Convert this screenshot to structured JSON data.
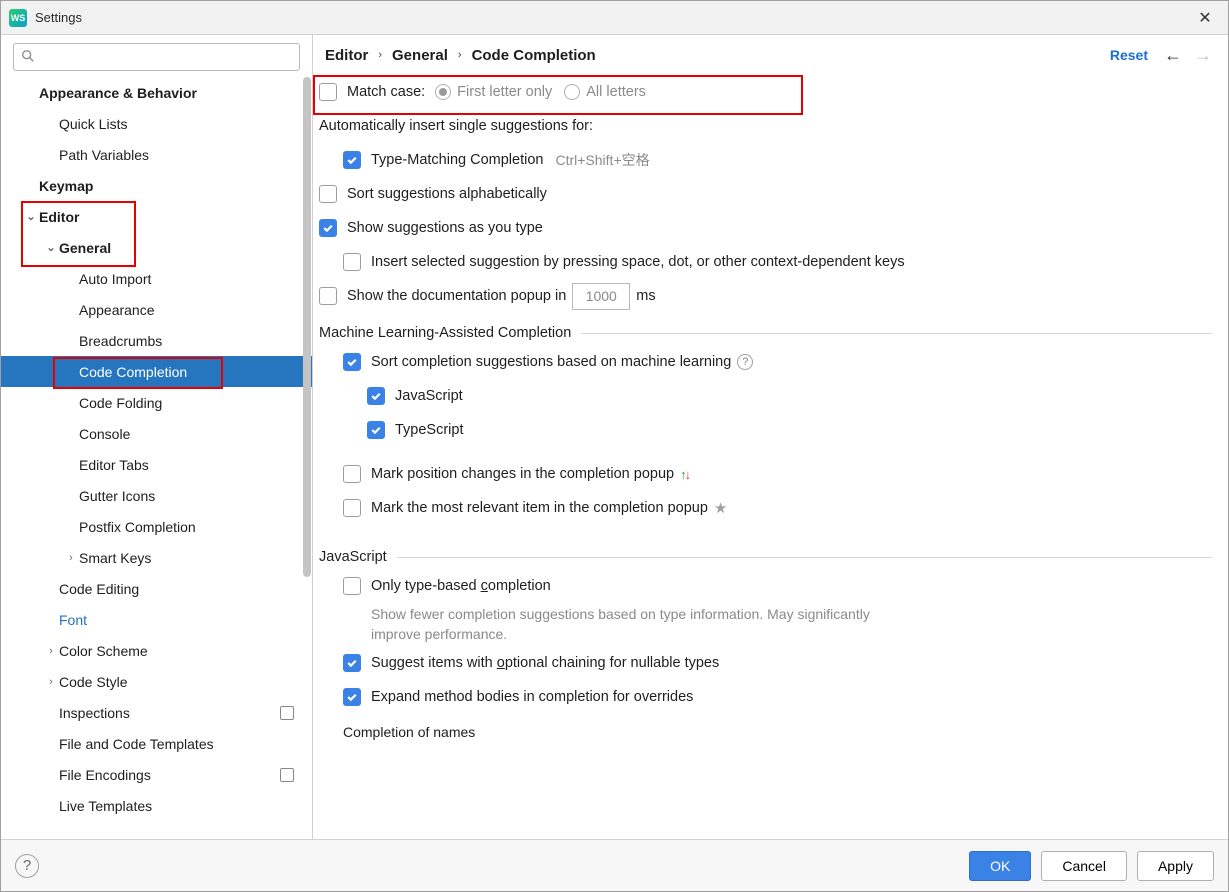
{
  "window": {
    "title": "Settings",
    "app_icon_text": "WS"
  },
  "search": {
    "placeholder": ""
  },
  "sidebar": [
    {
      "label": "Appearance & Behavior",
      "lvl": 0,
      "bold": true
    },
    {
      "label": "Quick Lists",
      "lvl": 1
    },
    {
      "label": "Path Variables",
      "lvl": 1
    },
    {
      "label": "Keymap",
      "lvl": 0,
      "bold": true
    },
    {
      "label": "Editor",
      "lvl": 0,
      "bold": true,
      "chev": "down"
    },
    {
      "label": "General",
      "lvl": 1,
      "bold": true,
      "chev": "down"
    },
    {
      "label": "Auto Import",
      "lvl": 2
    },
    {
      "label": "Appearance",
      "lvl": 2
    },
    {
      "label": "Breadcrumbs",
      "lvl": 2
    },
    {
      "label": "Code Completion",
      "lvl": 2,
      "selected": true
    },
    {
      "label": "Code Folding",
      "lvl": 2
    },
    {
      "label": "Console",
      "lvl": 2
    },
    {
      "label": "Editor Tabs",
      "lvl": 2
    },
    {
      "label": "Gutter Icons",
      "lvl": 2
    },
    {
      "label": "Postfix Completion",
      "lvl": 2
    },
    {
      "label": "Smart Keys",
      "lvl": 2,
      "chev": "right"
    },
    {
      "label": "Code Editing",
      "lvl": 1
    },
    {
      "label": "Font",
      "lvl": 1,
      "link": true
    },
    {
      "label": "Color Scheme",
      "lvl": 1,
      "chev": "right"
    },
    {
      "label": "Code Style",
      "lvl": 1,
      "chev": "right"
    },
    {
      "label": "Inspections",
      "lvl": 1,
      "proj": true
    },
    {
      "label": "File and Code Templates",
      "lvl": 1
    },
    {
      "label": "File Encodings",
      "lvl": 1,
      "proj": true
    },
    {
      "label": "Live Templates",
      "lvl": 1
    }
  ],
  "breadcrumb": [
    "Editor",
    "General",
    "Code Completion"
  ],
  "reset_label": "Reset",
  "options": {
    "match_case": {
      "label": "Match case:",
      "checked": false,
      "first_letter": "First letter only",
      "all_letters": "All letters",
      "radio_sel": "first"
    },
    "auto_insert_hdr": "Automatically insert single suggestions for:",
    "type_matching": {
      "label": "Type-Matching Completion",
      "checked": true,
      "kbd": "Ctrl+Shift+空格"
    },
    "sort_alpha": {
      "label": "Sort suggestions alphabetically",
      "checked": false
    },
    "show_as_type": {
      "label": "Show suggestions as you type",
      "checked": true
    },
    "insert_space": {
      "label": "Insert selected suggestion by pressing space, dot, or other context-dependent keys",
      "checked": false
    },
    "show_doc": {
      "label_pre": "Show the documentation popup in",
      "value": "1000",
      "label_post": "ms",
      "checked": false
    },
    "ml_hdr": "Machine Learning-Assisted Completion",
    "ml_sort": {
      "label": "Sort completion suggestions based on machine learning",
      "checked": true
    },
    "ml_js": {
      "label": "JavaScript",
      "checked": true
    },
    "ml_ts": {
      "label": "TypeScript",
      "checked": true
    },
    "mark_pos": {
      "label": "Mark position changes in the completion popup",
      "checked": false
    },
    "mark_rel": {
      "label": "Mark the most relevant item in the completion popup",
      "checked": false
    },
    "js_hdr": "JavaScript",
    "js_typebased": {
      "label": "Only type-based completion",
      "checked": false,
      "hint": "Show fewer completion suggestions based on type information. May significantly improve performance."
    },
    "js_optional": {
      "label": "Suggest items with optional chaining for nullable types",
      "checked": true
    },
    "js_expand": {
      "label": "Expand method bodies in completion for overrides",
      "checked": true
    },
    "js_names_hdr": "Completion of names"
  },
  "footer": {
    "ok": "OK",
    "cancel": "Cancel",
    "apply": "Apply"
  }
}
